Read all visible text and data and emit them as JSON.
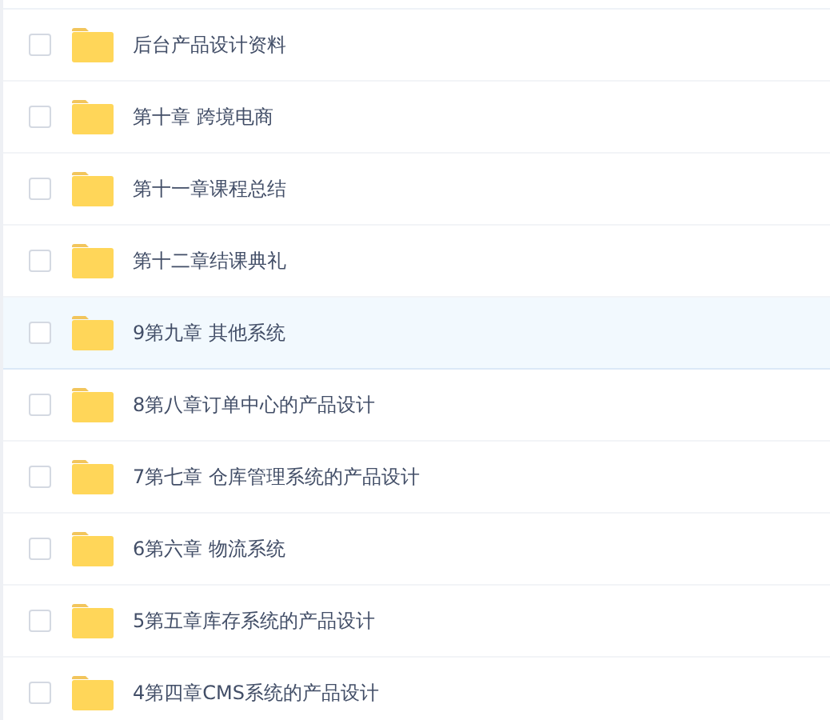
{
  "files": [
    {
      "name": "后台产品设计资料",
      "checked": false,
      "highlighted": false
    },
    {
      "name": "第十章 跨境电商",
      "checked": false,
      "highlighted": false
    },
    {
      "name": "第十一章课程总结",
      "checked": false,
      "highlighted": false
    },
    {
      "name": "第十二章结课典礼",
      "checked": false,
      "highlighted": false
    },
    {
      "name": "9第九章 其他系统",
      "checked": false,
      "highlighted": true
    },
    {
      "name": "8第八章订单中心的产品设计",
      "checked": false,
      "highlighted": false
    },
    {
      "name": "7第七章 仓库管理系统的产品设计",
      "checked": false,
      "highlighted": false
    },
    {
      "name": "6第六章 物流系统",
      "checked": false,
      "highlighted": false
    },
    {
      "name": "5第五章库存系统的产品设计",
      "checked": false,
      "highlighted": false
    },
    {
      "name": "4第四章CMS系统的产品设计",
      "checked": false,
      "highlighted": false
    }
  ]
}
